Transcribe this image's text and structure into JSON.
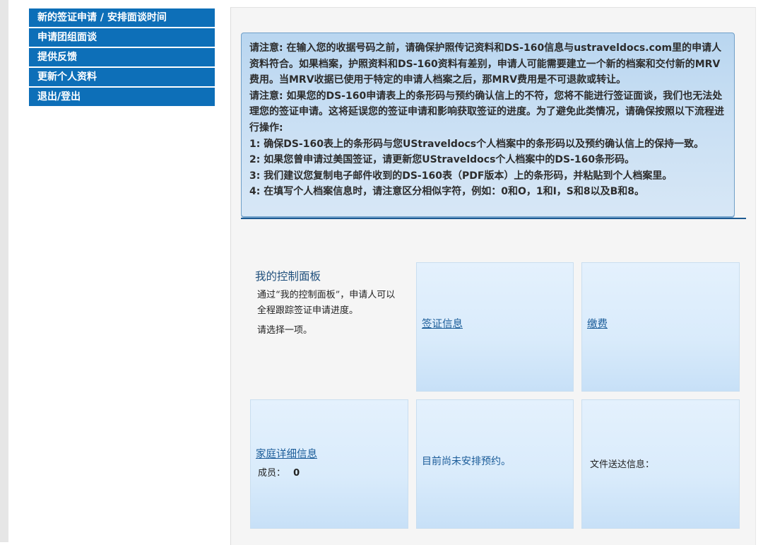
{
  "sidebar": {
    "items": [
      {
        "label": "新的签证申请 / 安排面谈时间"
      },
      {
        "label": "申请团组面谈"
      },
      {
        "label": "提供反馈"
      },
      {
        "label": "更新个人资料"
      },
      {
        "label": "退出/登出"
      }
    ]
  },
  "notice": {
    "lines": [
      "请注意: 在输入您的收据号码之前，请确保护照传记资料和DS-160信息与ustraveldocs.com里的申请人资料符合。如果档案，护照资料和DS-160资料有差别，申请人可能需要建立一个新的档案和交付新的MRV费用。当MRV收据已使用于特定的申请人档案之后，那MRV费用是不可退款或转让。",
      "请注意: 如果您的DS-160申请表上的条形码与预约确认信上的不符，您将不能进行签证面谈，我们也无法处理您的签证申请。这将延误您的签证申请和影响获取签证的进度。为了避免此类情况，请确保按照以下流程进行操作:",
      "1: 确保DS-160表上的条形码与您UStraveldocs个人档案中的条形码以及预约确认信上的保持一致。",
      "2: 如果您曾申请过美国签证，请更新您UStraveldocs个人档案中的DS-160条形码。",
      "3: 我们建议您复制电子邮件收到的DS-160表（PDF版本）上的条形码，并粘贴到个人档案里。",
      "4: 在填写个人档案信息时，请注意区分相似字符，例如：0和O，1和I，S和8以及B和8。"
    ]
  },
  "dashboard": {
    "title": "我的控制面板",
    "description": "通过“我的控制面板”，申请人可以全程跟踪签证申请进度。",
    "prompt": "请选择一项。"
  },
  "tiles": {
    "visa_info": "签证信息",
    "payment": "缴费",
    "family_details": "家庭详细信息",
    "members_label": "成员：",
    "members_count": "0",
    "appointment_status": "目前尚未安排预约。",
    "document_delivery": "文件送达信息："
  }
}
